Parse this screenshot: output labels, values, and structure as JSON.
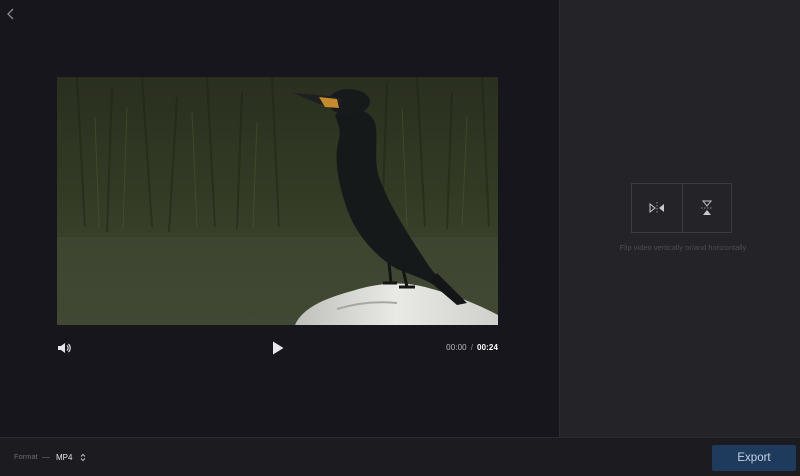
{
  "player": {
    "current_time": "00:00",
    "separator": "/",
    "duration": "00:24"
  },
  "flip": {
    "horizontal_icon": "flip-horizontal-icon",
    "vertical_icon": "flip-vertical-icon",
    "hint": "Flip video vertically or/and horizontally"
  },
  "footer": {
    "format_label": "Format",
    "format_value": "MP4",
    "export_label": "Export"
  },
  "colors": {
    "background": "#17161c",
    "side_panel": "#232328",
    "export_button": "#1e3b5e"
  }
}
